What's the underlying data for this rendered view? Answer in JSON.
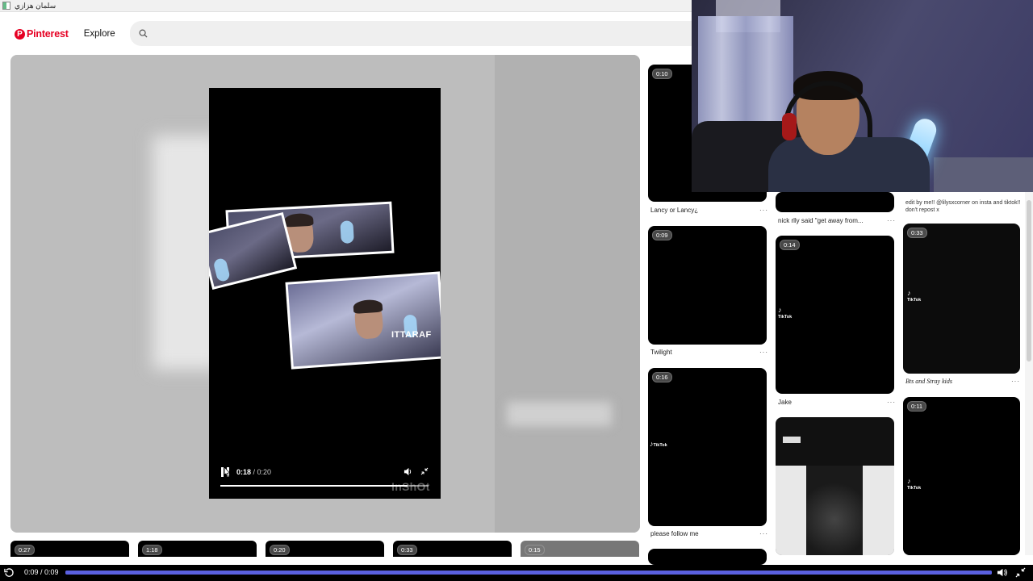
{
  "window": {
    "title": "سلمان هزازي"
  },
  "header": {
    "brand": "Pinterest",
    "brand_mark": "P",
    "nav_explore": "Explore",
    "search_placeholder": ""
  },
  "player": {
    "current": "0:18",
    "separator": " / ",
    "duration": "0:20",
    "progress": 0.9,
    "overlay_text": "ITTARAF",
    "watermark": "InShOt"
  },
  "bottom_thumbs": [
    {
      "duration": "0:27"
    },
    {
      "duration": "1:18"
    },
    {
      "duration": "0:20"
    },
    {
      "duration": "0:33"
    },
    {
      "duration": "0:15"
    }
  ],
  "grid": {
    "col1": [
      {
        "duration": "0:10",
        "title": "Lancy or Lancy¿"
      },
      {
        "duration": "0:09",
        "title": "Twilight"
      },
      {
        "duration": "0:16",
        "title": "please follow me"
      }
    ],
    "col2": [
      {
        "title": "nick rlly said \"get away from..."
      },
      {
        "duration": "0:14",
        "title": "Jake"
      }
    ],
    "col3": [
      {
        "caption": "edit by me!! @lilysxcorner on insta and tiktok!! don't repost x"
      },
      {
        "duration": "0:33",
        "title": "Bts and Stray kids"
      },
      {
        "duration": "0:11"
      }
    ],
    "more_icon": "···",
    "tiktok_label": "TikTok"
  },
  "mediabar": {
    "time": "0:09 / 0:09",
    "progress": 1.0
  },
  "icons": {
    "search": "search-icon",
    "play_pause": "pause-icon",
    "volume": "volume-icon",
    "fullscreen": "fullscreen-icon",
    "replay": "replay-icon"
  },
  "colors": {
    "brand": "#e60023",
    "media_progress": "#5a60e0"
  }
}
